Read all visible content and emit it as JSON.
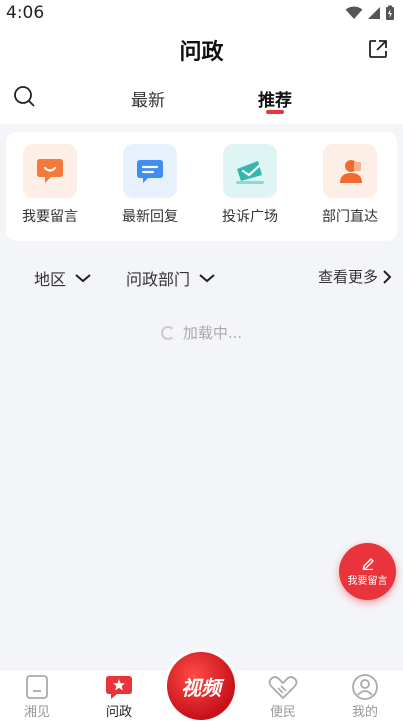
{
  "status_bar": {
    "time": "4:06"
  },
  "header": {
    "title": "问政"
  },
  "tabs": [
    {
      "label": "最新"
    },
    {
      "label": "推荐"
    }
  ],
  "quick_actions": [
    {
      "label": "我要留言",
      "icon": "speech-bubble-icon",
      "color": "#f57a3a"
    },
    {
      "label": "最新回复",
      "icon": "message-icon",
      "color": "#3f8cf4"
    },
    {
      "label": "投诉广场",
      "icon": "envelope-icon",
      "color": "#33b7b0"
    },
    {
      "label": "部门直达",
      "icon": "person-icon",
      "color": "#f26a2e"
    }
  ],
  "filters": {
    "region": "地区",
    "department": "问政部门",
    "more": "查看更多"
  },
  "loading_text": "加载中...",
  "fab": {
    "label": "我要留言"
  },
  "bottom_nav": {
    "items": [
      {
        "label": "湘见"
      },
      {
        "label": "问政"
      },
      {
        "label": "视频"
      },
      {
        "label": "便民"
      },
      {
        "label": "我的"
      }
    ]
  },
  "colors": {
    "accent": "#e8343a",
    "background": "#f4f5f9"
  }
}
